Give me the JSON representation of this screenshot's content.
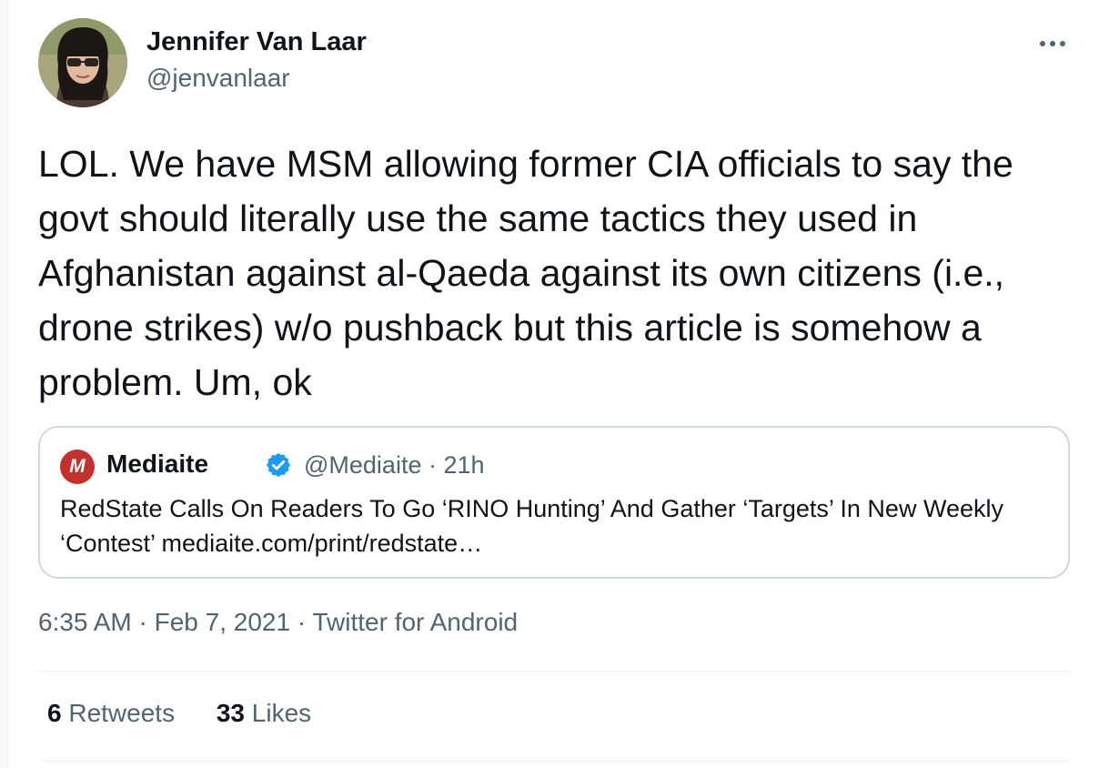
{
  "author": {
    "name": "Jennifer Van Laar",
    "handle": "@jenvanlaar"
  },
  "tweet": {
    "text": "LOL. We have MSM allowing former CIA officials to say the govt should literally use the same tactics they used in Afghanistan against al-Qaeda against its own citizens (i.e., drone strikes) w/o pushback but this article is somehow a problem. Um, ok"
  },
  "quote": {
    "logo_letter": "M",
    "name": "Mediaite",
    "handle": "@Mediaite",
    "separator": "·",
    "time": "21h",
    "text": "RedState Calls On Readers To Go ‘RINO Hunting’ And Gather ‘Targets’ In New Weekly ‘Contest’ mediaite.com/print/redstate…"
  },
  "meta": {
    "time": "6:35 AM",
    "separator": "·",
    "date": "Feb 7, 2021",
    "source": "Twitter for Android"
  },
  "stats": {
    "retweets_count": "6",
    "retweets_label": "Retweets",
    "likes_count": "33",
    "likes_label": "Likes"
  },
  "colors": {
    "text": "#0f1419",
    "secondary": "#536471",
    "border": "#cfd9de",
    "verified": "#1d9bf0",
    "mediaite_red": "#c4302b"
  },
  "icons": [
    "more-icon",
    "verified-badge-icon",
    "mediaite-logo-icon"
  ]
}
